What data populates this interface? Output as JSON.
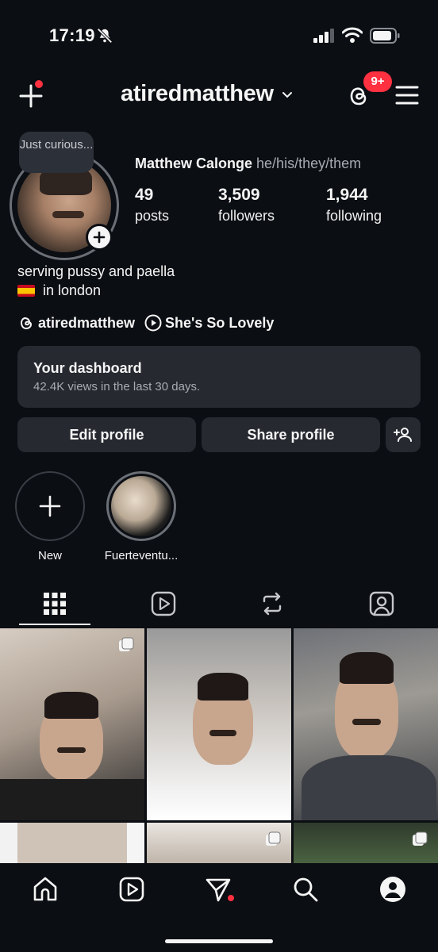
{
  "status_bar": {
    "time": "17:19"
  },
  "header": {
    "username": "atiredmatthew",
    "threads_badge": "9+"
  },
  "profile": {
    "note": "Just curious...",
    "full_name": "Matthew Calonge",
    "pronouns": "he/his/they/them",
    "stats": [
      {
        "value": "49",
        "label": "posts"
      },
      {
        "value": "3,509",
        "label": "followers"
      },
      {
        "value": "1,944",
        "label": "following"
      }
    ],
    "bio_line1": "serving pussy and paella",
    "bio_line2": "in london",
    "threads_link": "atiredmatthew",
    "music_link": "She's So Lovely"
  },
  "dashboard": {
    "title": "Your dashboard",
    "subtitle": "42.4K views in the last 30 days."
  },
  "actions": {
    "edit_profile": "Edit profile",
    "share_profile": "Share profile"
  },
  "highlights": [
    {
      "label": "New"
    },
    {
      "label": "Fuerteventu..."
    }
  ],
  "tabs": [
    "grid-icon",
    "reels-icon",
    "reposts-icon",
    "tagged-icon"
  ],
  "bottom_nav": [
    "home-icon",
    "reels-icon",
    "direct-icon",
    "search-icon",
    "profile-icon"
  ],
  "colors": {
    "background": "#0b0e13",
    "surface": "#262930",
    "badge": "#ff3040",
    "secondary_text": "#a8abb2"
  }
}
